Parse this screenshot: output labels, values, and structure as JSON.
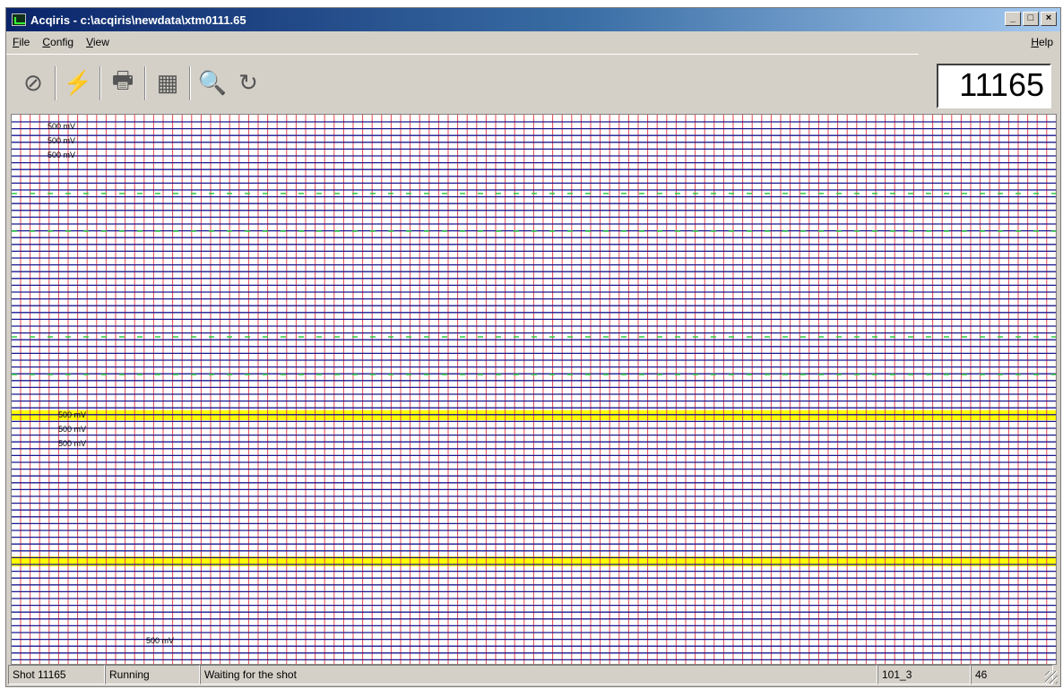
{
  "window": {
    "title": "Acqiris - c:\\acqiris\\newdata\\xtm0111.65",
    "controls": [
      "_",
      "□",
      "×"
    ]
  },
  "menu": {
    "file": "File",
    "config": "Config",
    "view": "View",
    "help": "Help"
  },
  "toolbar": {
    "buttons": [
      {
        "name": "stop-icon",
        "glyph": "⊘"
      },
      {
        "name": "connect-icon",
        "glyph": "⚡"
      },
      {
        "name": "print-icon",
        "glyph": "🖶"
      },
      {
        "name": "export-icon",
        "glyph": "▦"
      },
      {
        "name": "zoom-icon",
        "glyph": "🔍"
      },
      {
        "name": "zoom-reset-icon",
        "glyph": "↻"
      }
    ]
  },
  "shot_counter": "11165",
  "plot": {
    "colors": {
      "vertical_grid": "#e8434b",
      "trace": "#17178f",
      "highlight": "#ffff00",
      "noise": "#2ecc40"
    },
    "groups": [
      {
        "channel_label": "500 mV"
      },
      {
        "channel_label": "500 mV"
      }
    ],
    "bottom_label": "500 mV"
  },
  "status": {
    "shot": "Shot 11165",
    "state": "Running",
    "message": "Waiting for the shot",
    "channel": "101_3",
    "count": "46"
  }
}
